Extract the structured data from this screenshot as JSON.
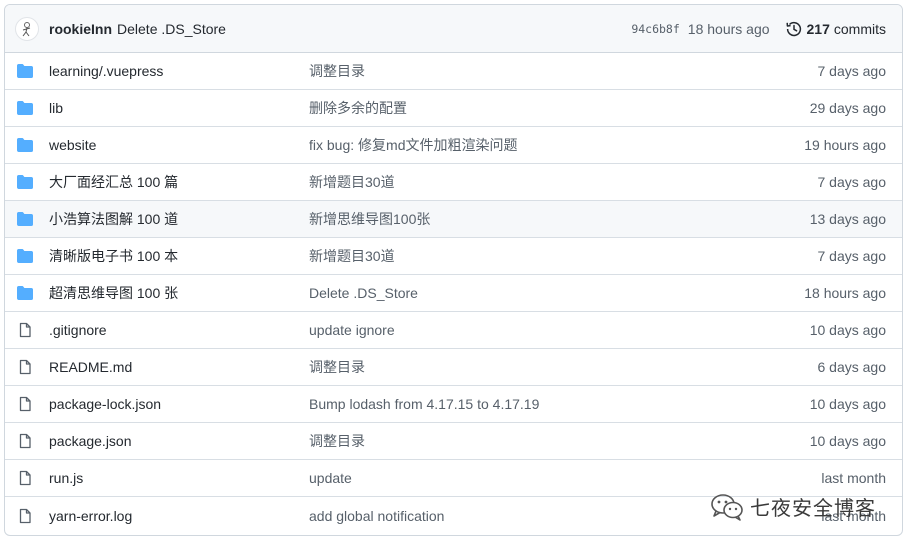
{
  "latest_commit": {
    "author": "rookieInn",
    "message": "Delete .DS_Store",
    "sha": "94c6b8f",
    "age": "18 hours ago",
    "commits_count": "217",
    "commits_label": "commits"
  },
  "files": [
    {
      "type": "folder",
      "name": "learning/.vuepress",
      "commit": "调整目录",
      "age": "7 days ago"
    },
    {
      "type": "folder",
      "name": "lib",
      "commit": "删除多余的配置",
      "age": "29 days ago"
    },
    {
      "type": "folder",
      "name": "website",
      "commit": "fix bug: 修复md文件加粗渲染问题",
      "age": "19 hours ago"
    },
    {
      "type": "folder",
      "name": "大厂面经汇总 100 篇",
      "commit": "新增题目30道",
      "age": "7 days ago"
    },
    {
      "type": "folder",
      "name": "小浩算法图解 100 道",
      "commit": "新增思维导图100张",
      "age": "13 days ago"
    },
    {
      "type": "folder",
      "name": "清晰版电子书 100 本",
      "commit": "新增题目30道",
      "age": "7 days ago"
    },
    {
      "type": "folder",
      "name": "超清思维导图 100 张",
      "commit": "Delete .DS_Store",
      "age": "18 hours ago"
    },
    {
      "type": "file",
      "name": ".gitignore",
      "commit": "update ignore",
      "age": "10 days ago"
    },
    {
      "type": "file",
      "name": "README.md",
      "commit": "调整目录",
      "age": "6 days ago"
    },
    {
      "type": "file",
      "name": "package-lock.json",
      "commit": "Bump lodash from 4.17.15 to 4.17.19",
      "age": "10 days ago"
    },
    {
      "type": "file",
      "name": "package.json",
      "commit": "调整目录",
      "age": "10 days ago"
    },
    {
      "type": "file",
      "name": "run.js",
      "commit": "update",
      "age": "last month"
    },
    {
      "type": "file",
      "name": "yarn-error.log",
      "commit": "add global notification",
      "age": "last month"
    }
  ],
  "watermark": {
    "text": "七夜安全博客",
    "icon": "wechat-icon"
  },
  "colors": {
    "folder": "#54aeff",
    "file": "#57606a",
    "header_bg": "#f6f8fa",
    "border": "#d0d7de"
  }
}
